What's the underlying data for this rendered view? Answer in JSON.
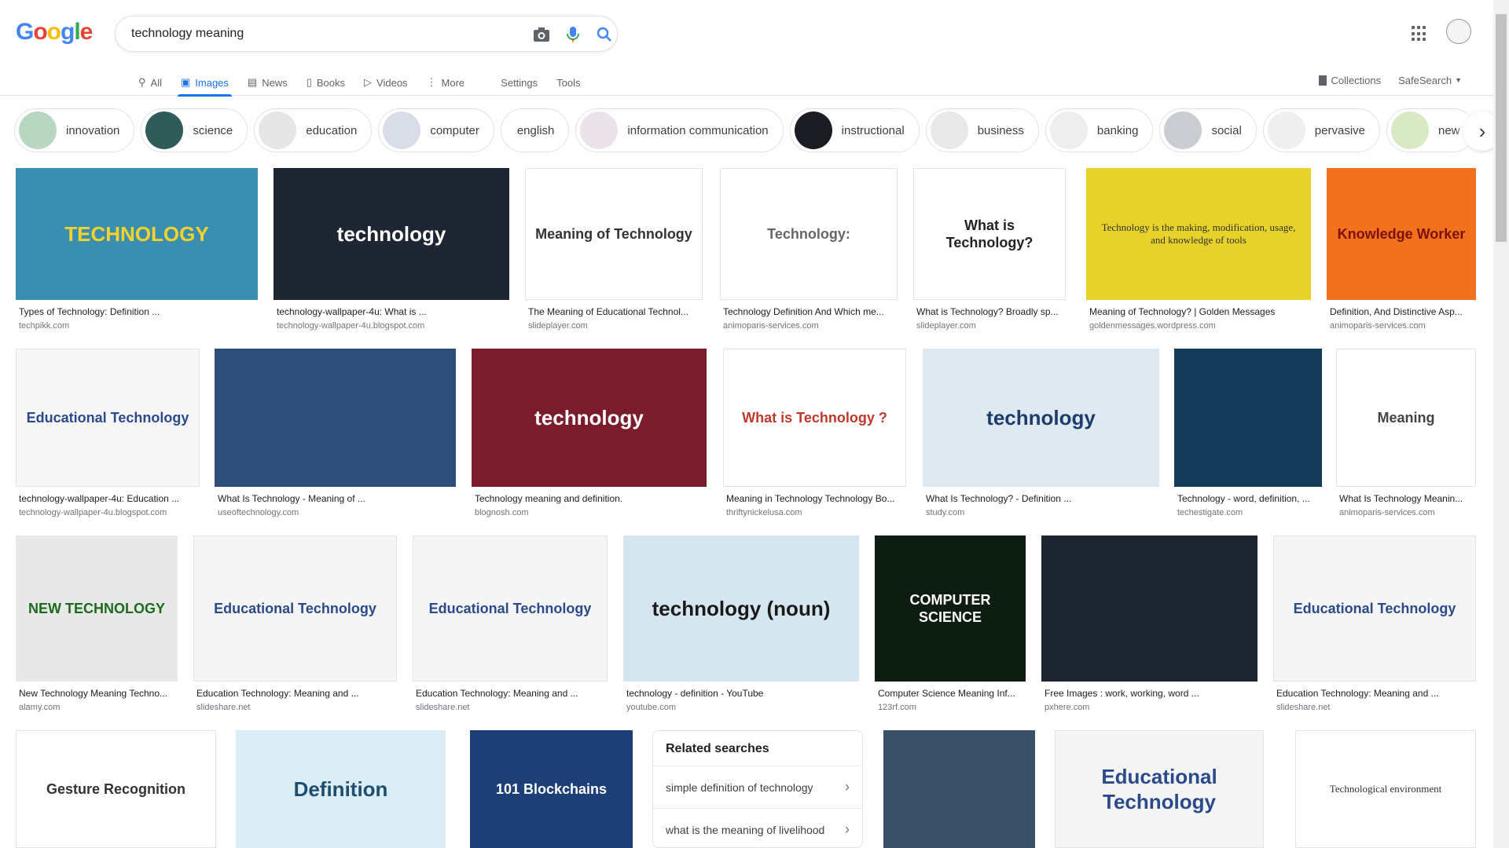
{
  "logo": {
    "letters": [
      "G",
      "o",
      "o",
      "g",
      "l",
      "e"
    ],
    "colors": [
      "#4285f4",
      "#ea4335",
      "#fbbc05",
      "#4285f4",
      "#34a853",
      "#ea4335"
    ]
  },
  "search": {
    "value": "technology meaning",
    "camera_icon": "camera-icon",
    "mic_icon": "microphone-icon",
    "search_icon": "search-icon"
  },
  "tabs": [
    {
      "label": "All",
      "icon": "search-icon",
      "glyph": "⚲"
    },
    {
      "label": "Images",
      "icon": "image-icon",
      "glyph": "▣",
      "active": true
    },
    {
      "label": "News",
      "icon": "news-icon",
      "glyph": "▤"
    },
    {
      "label": "Books",
      "icon": "book-icon",
      "glyph": "▯"
    },
    {
      "label": "Videos",
      "icon": "video-icon",
      "glyph": "▷"
    },
    {
      "label": "More",
      "icon": "more-icon",
      "glyph": "⋮"
    }
  ],
  "tools": {
    "settings": "Settings",
    "tools": "Tools"
  },
  "header_right": {
    "collections": "Collections",
    "safesearch": "SafeSearch"
  },
  "chips": [
    {
      "label": "innovation",
      "thumb": "#b9d7c0"
    },
    {
      "label": "science",
      "thumb": "#2f5c58"
    },
    {
      "label": "education",
      "thumb": "#e6e6e6"
    },
    {
      "label": "computer",
      "thumb": "#d9dde8"
    },
    {
      "label": "english"
    },
    {
      "label": "information communication",
      "thumb": "#eae3ea"
    },
    {
      "label": "instructional",
      "thumb": "#1b1b24"
    },
    {
      "label": "business",
      "thumb": "#e9e9e9"
    },
    {
      "label": "banking",
      "thumb": "#eeeeee"
    },
    {
      "label": "social",
      "thumb": "#c9ccd1"
    },
    {
      "label": "pervasive",
      "thumb": "#efefef"
    },
    {
      "label": "new",
      "thumb": "#d8e9c4"
    }
  ],
  "images_row1": [
    {
      "title": "Types of Technology: Definition ...",
      "source": "techpikk.com",
      "thumb_text": "TECHNOLOGY",
      "bg": "#3a8fb0",
      "fg": "#f7d22c"
    },
    {
      "title": "technology-wallpaper-4u: What is ...",
      "source": "technology-wallpaper-4u.blogspot.com",
      "thumb_text": "technology",
      "bg": "#1f2633",
      "fg": "#ffffff"
    },
    {
      "title": "The Meaning of Educational Technol...",
      "source": "slideplayer.com",
      "thumb_text": "Meaning of Technology",
      "bg": "#ffffff",
      "fg": "#333333"
    },
    {
      "title": "Technology Definition And Which me...",
      "source": "animoparis-services.com",
      "thumb_text": "Technology:",
      "bg": "#ffffff",
      "fg": "#666666"
    },
    {
      "title": "What is Technology? Broadly sp...",
      "source": "slideplayer.com",
      "thumb_text": "What is Technology?",
      "bg": "#ffffff",
      "fg": "#222222"
    },
    {
      "title": "Meaning of Technology? | Golden Messages",
      "source": "goldenmessages.wordpress.com",
      "thumb_text": "Technology is the making, modification, usage, and knowledge of tools",
      "bg": "#e6d22a",
      "fg": "#333333"
    },
    {
      "title": "Definition, And Distinctive Asp...",
      "source": "animoparis-services.com",
      "thumb_text": "Knowledge Worker",
      "bg": "#f2711c",
      "fg": "#7a1010"
    }
  ],
  "images_row2": [
    {
      "title": "technology-wallpaper-4u: Education ...",
      "source": "technology-wallpaper-4u.blogspot.com",
      "thumb_text": "Educational Technology",
      "bg": "#f7f7f7",
      "fg": "#2b4a8a"
    },
    {
      "title": "What Is Technology - Meaning of ...",
      "source": "useoftechnology.com",
      "thumb_text": "",
      "bg": "#2f4d7a",
      "fg": "#ffffff"
    },
    {
      "title": "Technology meaning and definition.",
      "source": "blognosh.com",
      "thumb_text": "technology",
      "bg": "#7a1c2c",
      "fg": "#ffffff"
    },
    {
      "title": "Meaning in Technology Technology Bo...",
      "source": "thriftynickelusa.com",
      "thumb_text": "What is Technology ?",
      "bg": "#ffffff",
      "fg": "#c0392b"
    },
    {
      "title": "What Is Technology? - Definition ...",
      "source": "study.com",
      "thumb_text": "technology",
      "bg": "#dfe9f2",
      "fg": "#1d3b6b"
    },
    {
      "title": "Technology - word, definition, ...",
      "source": "techestigate.com",
      "thumb_text": "",
      "bg": "#143b58",
      "fg": "#ffffff"
    },
    {
      "title": "What Is Technology Meanin...",
      "source": "animoparis-services.com",
      "thumb_text": "Meaning",
      "bg": "#ffffff",
      "fg": "#444444"
    }
  ],
  "images_row3": [
    {
      "title": "New Technology Meaning Techno...",
      "source": "alamy.com",
      "thumb_text": "NEW TECHNOLOGY",
      "bg": "#e8e8e8",
      "fg": "#1c6b1c"
    },
    {
      "title": "Education Technology: Meaning and ...",
      "source": "slideshare.net",
      "thumb_text": "Educational Technology",
      "bg": "#f5f5f5",
      "fg": "#2b4a8a"
    },
    {
      "title": "Education Technology: Meaning and ...",
      "source": "slideshare.net",
      "thumb_text": "Educational Technology",
      "bg": "#f5f5f5",
      "fg": "#2b4a8a"
    },
    {
      "title": "technology - definition - YouTube",
      "source": "youtube.com",
      "thumb_text": "technology (noun)",
      "bg": "#d6e6f0",
      "fg": "#1a1a1a"
    },
    {
      "title": "Computer Science Meaning Inf...",
      "source": "123rf.com",
      "thumb_text": "COMPUTER SCIENCE",
      "bg": "#0e1d12",
      "fg": "#ffffff"
    },
    {
      "title": "Free Images : work, working, word ...",
      "source": "pxhere.com",
      "thumb_text": "",
      "bg": "#1c2530",
      "fg": "#a0c0d0"
    },
    {
      "title": "Education Technology: Meaning and ...",
      "source": "slideshare.net",
      "thumb_text": "Educational Technology",
      "bg": "#f5f5f5",
      "fg": "#2b4a8a"
    }
  ],
  "images_row4": [
    {
      "thumb_text": "Gesture Recognition",
      "bg": "#ffffff",
      "fg": "#333333"
    },
    {
      "thumb_text": "Definition",
      "bg": "#dbeef6",
      "fg": "#1d4e6e"
    },
    {
      "thumb_text": "101 Blockchains",
      "bg": "#1d3f78",
      "fg": "#ffffff"
    },
    {
      "thumb_text": "",
      "bg": "#3a5068",
      "fg": "#ffffff"
    },
    {
      "thumb_text": "Educational Technology",
      "bg": "#f5f5f5",
      "fg": "#2b4a8a"
    },
    {
      "thumb_text": "Technological environment",
      "bg": "#ffffff",
      "fg": "#333333"
    }
  ],
  "related": {
    "title": "Related searches",
    "items": [
      "simple definition of technology",
      "what is the meaning of livelihood"
    ]
  }
}
